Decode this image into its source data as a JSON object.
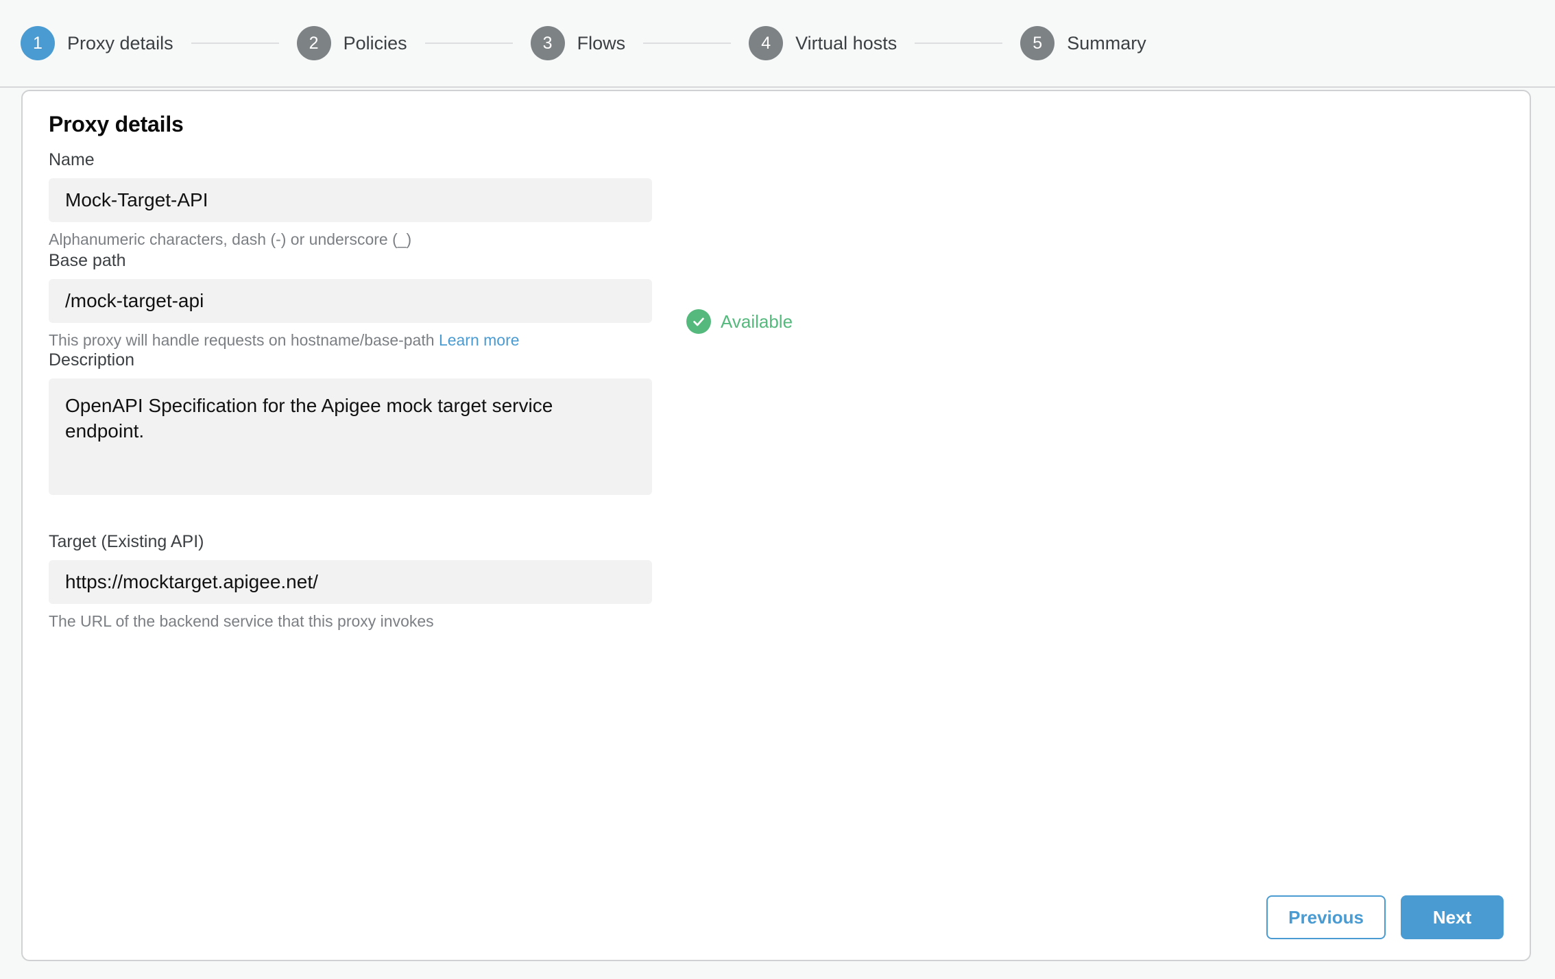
{
  "stepper": {
    "steps": [
      {
        "number": "1",
        "label": "Proxy details",
        "active": true
      },
      {
        "number": "2",
        "label": "Policies",
        "active": false
      },
      {
        "number": "3",
        "label": "Flows",
        "active": false
      },
      {
        "number": "4",
        "label": "Virtual hosts",
        "active": false
      },
      {
        "number": "5",
        "label": "Summary",
        "active": false
      }
    ]
  },
  "card": {
    "title": "Proxy details",
    "fields": {
      "name": {
        "label": "Name",
        "value": "Mock-Target-API",
        "hint": "Alphanumeric characters, dash (-) or underscore (_)"
      },
      "base_path": {
        "label": "Base path",
        "value": "/mock-target-api",
        "hint": "This proxy will handle requests on hostname/base-path",
        "hint_link": "Learn more"
      },
      "description": {
        "label": "Description",
        "value": "OpenAPI Specification for the Apigee mock target service endpoint."
      },
      "target": {
        "label": "Target (Existing API)",
        "value": "https://mocktarget.apigee.net/",
        "hint": "The URL of the backend service that this proxy invokes"
      }
    },
    "availability": {
      "icon": "check-circle-icon",
      "label": "Available"
    },
    "footer": {
      "previous_label": "Previous",
      "next_label": "Next"
    }
  },
  "colors": {
    "accent": "#4a9bd1",
    "success": "#55b97d",
    "step_inactive": "#7d8285",
    "page_bg": "#f7f8f8",
    "input_bg": "#f2f2f2"
  }
}
